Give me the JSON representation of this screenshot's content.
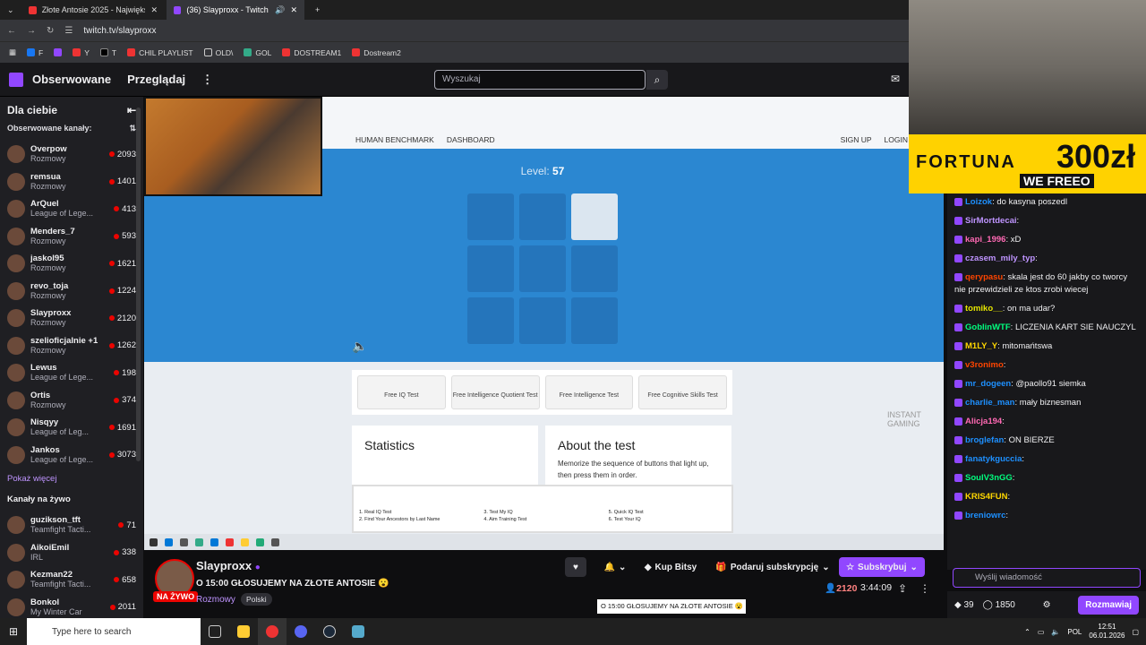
{
  "browser": {
    "tabs": [
      {
        "title": "Złote Antosie 2025 - Największ"
      },
      {
        "title": "(36) Slayproxx - Twitch"
      }
    ],
    "url": "twitch.tv/slayproxx",
    "bookmarks": [
      "F",
      "Y",
      "T",
      "CHIL PLAYLIST",
      "OLD\\",
      "GOL",
      "DOSTREAM1",
      "Dostream2"
    ]
  },
  "twitch_nav": {
    "followed": "Obserwowane",
    "browse": "Przeglądaj",
    "search_placeholder": "Wyszukaj"
  },
  "sidebar": {
    "header": "Dla ciebie",
    "followed_header": "Obserwowane kanały:",
    "channels": [
      {
        "name": "Overpow",
        "category": "Rozmowy",
        "viewers": "2093"
      },
      {
        "name": "remsua",
        "category": "Rozmowy",
        "viewers": "1401"
      },
      {
        "name": "ArQuel",
        "category": "League of Lege...",
        "viewers": "413"
      },
      {
        "name": "Menders_7",
        "category": "Rozmowy",
        "viewers": "593"
      },
      {
        "name": "jaskol95",
        "category": "Rozmowy",
        "viewers": "1621"
      },
      {
        "name": "revo_toja",
        "category": "Rozmowy",
        "viewers": "1224"
      },
      {
        "name": "Slayproxx",
        "category": "Rozmowy",
        "viewers": "2120"
      },
      {
        "name": "szelioficjalnie +1",
        "category": "Rozmowy",
        "viewers": "1262"
      },
      {
        "name": "Lewus",
        "category": "League of Lege...",
        "viewers": "198"
      },
      {
        "name": "Ortis",
        "category": "Rozmowy",
        "viewers": "374"
      },
      {
        "name": "Nisqyy",
        "category": "League of Leg...",
        "viewers": "1691"
      },
      {
        "name": "Jankos",
        "category": "League of Lege...",
        "viewers": "3073"
      }
    ],
    "show_more": "Pokaż więcej",
    "live_header": "Kanały na żywo",
    "live_channels": [
      {
        "name": "guzikson_tft",
        "category": "Teamfight Tacti...",
        "viewers": "71"
      },
      {
        "name": "AikoiEmil",
        "category": "IRL",
        "viewers": "338"
      },
      {
        "name": "Kezman22",
        "category": "Teamfight Tacti...",
        "viewers": "658"
      },
      {
        "name": "Bonkol",
        "category": "My Winter Car",
        "viewers": "2011"
      }
    ]
  },
  "game": {
    "site_nav": [
      "HUMAN BENCHMARK",
      "DASHBOARD"
    ],
    "site_auth": [
      "SIGN UP",
      "LOGIN"
    ],
    "level_label": "Level:",
    "level_value": "57",
    "ads": [
      "Free IQ Test",
      "Free Intelligence Quotient Test",
      "Free Intelligence Test",
      "Free Cognitive Skills Test"
    ],
    "stats_title": "Statistics",
    "about_title": "About the test",
    "about_text": "Memorize the sequence of buttons that light up, then press them in order.",
    "bottom_ads": [
      "1. Real IQ Test",
      "2. Find Your Ancestors by Last Name",
      "3. Test My IQ",
      "4. Aim Training Test",
      "5. Quick IQ Test",
      "6. Test Your IQ"
    ],
    "instant_gaming": "INSTANT GAMING"
  },
  "stream": {
    "name": "Slayproxx",
    "live_label": "NA ŻYWO",
    "title": "O 15:00 GŁOSUJEMY NA ZŁOTE ANTOSIE 😮",
    "category": "Rozmowy",
    "tag": "Polski",
    "bits_label": "Kup Bitsy",
    "gift_label": "Podaruj subskrypcję",
    "subscribe_label": "Subskrybuj",
    "viewers": "2120",
    "uptime": "3:44:09",
    "tooltip": "O 15:00 GŁOSUJEMY NA ZŁOTE ANTOSIE 😮"
  },
  "overlay": {
    "brand": "FORTUNA",
    "amount": "300zł",
    "promo": "WE FREEO"
  },
  "chat": {
    "messages": [
      {
        "user": "Loizok",
        "color": "#1e90ff",
        "text": "do kasyna poszedl"
      },
      {
        "user": "SirMortdecai",
        "color": "#bf94ff",
        "text": ""
      },
      {
        "user": "kapi_1996",
        "color": "#ff69b4",
        "text": "xD"
      },
      {
        "user": "czasem_mily_typ",
        "color": "#bf94ff",
        "text": ""
      },
      {
        "user": "qerypasu",
        "color": "#ff4500",
        "text": "skala jest do 60 jakby co tworcy nie przewidzieli ze ktos zrobi wiecej"
      },
      {
        "user": "tomiko__",
        "color": "#e5e500",
        "text": "on ma udar?"
      },
      {
        "user": "GoblinWTF",
        "color": "#00ff7f",
        "text": "LICZENIA KART SIE NAUCZYL"
      },
      {
        "user": "M1LY_Y",
        "color": "#ffd700",
        "text": "mitomańtswa"
      },
      {
        "user": "v3ronimo",
        "color": "#ff4500",
        "text": ""
      },
      {
        "user": "mr_dogeen",
        "color": "#1e90ff",
        "text": "@paollo91 siemka"
      },
      {
        "user": "charlie_man",
        "color": "#1e90ff",
        "text": "mały biznesman"
      },
      {
        "user": "Alicja194",
        "color": "#ff69b4",
        "text": ""
      },
      {
        "user": "broglefan",
        "color": "#1e90ff",
        "text": "ON BIERZE"
      },
      {
        "user": "fanatykguccia",
        "color": "#1e90ff",
        "text": ""
      },
      {
        "user": "SoulV3nGG",
        "color": "#00ff7f",
        "text": ""
      },
      {
        "user": "KRIS4FUN",
        "color": "#ffd700",
        "text": ""
      },
      {
        "user": "breniowrc",
        "color": "#1e90ff",
        "text": ""
      }
    ],
    "input_placeholder": "Wyślij wiadomość",
    "points": "39",
    "channel_points": "1850",
    "chat_button": "Rozmawiaj"
  },
  "taskbar": {
    "search_placeholder": "Type here to search",
    "lang": "POL",
    "time": "12:51",
    "date": "06.01.2026"
  },
  "colors": {
    "twitch_purple": "#9147ff",
    "live_red": "#eb0400",
    "game_blue": "#2b87d1"
  }
}
